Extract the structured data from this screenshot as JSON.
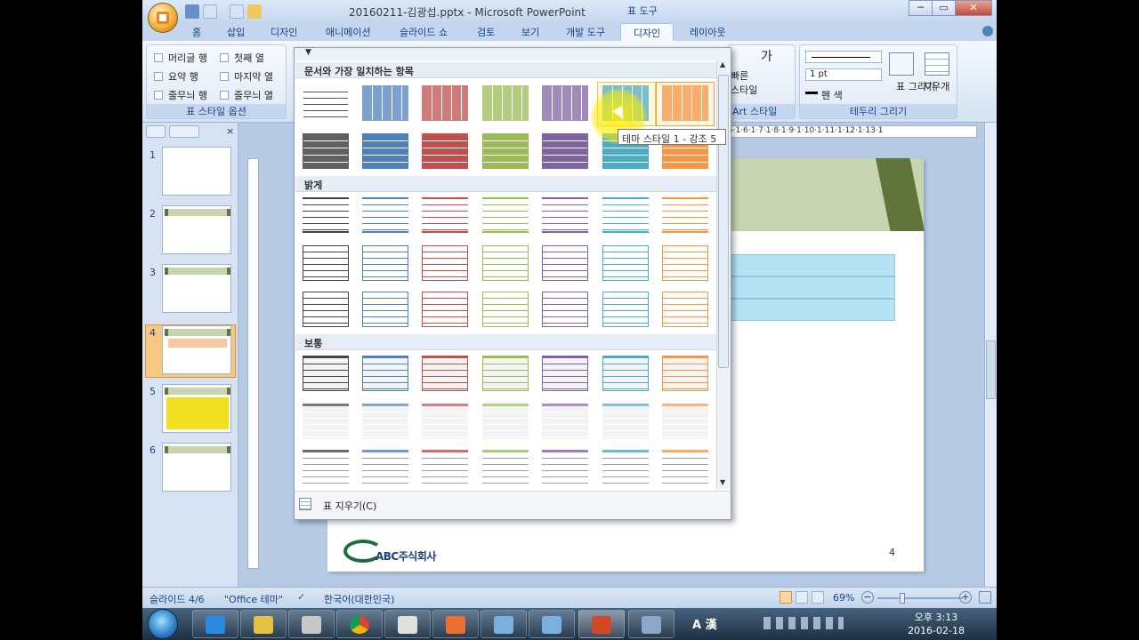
{
  "window": {
    "title": "20160211-김광섭.pptx - Microsoft PowerPoint",
    "context_tab_group": "표 도구",
    "buttons": {
      "minimize": "─",
      "restore": "▭",
      "close": "✕"
    }
  },
  "tabs": [
    "홈",
    "삽입",
    "디자인",
    "애니메이션",
    "슬라이드 쇼",
    "검토",
    "보기",
    "개발 도구",
    "디자인",
    "레이아웃"
  ],
  "active_tab": "디자인",
  "ribbon": {
    "table_style_options": {
      "label": "표 스타일 옵션",
      "options": [
        "머리글 행",
        "첫째 열",
        "요약 행",
        "마지막 열",
        "줄무늬 행",
        "줄무늬 열"
      ]
    },
    "wordart_fragments": [
      "가",
      "빠른",
      "스타일",
      "Art 스타일"
    ],
    "draw_borders": {
      "label": "테두리 그리기",
      "pen_weight": "1 pt",
      "pen_color": "펜 색",
      "draw_table": "표 그리기",
      "eraser": "지우개"
    }
  },
  "gallery": {
    "sections": [
      "문서와 가장 일치하는 항목",
      "밝게",
      "보통"
    ],
    "clear_table": "표 지우기(C)",
    "tooltip": "테마 스타일 1 - 강조 5",
    "accent_colors": [
      "#606060",
      "#4f81bd",
      "#c0504d",
      "#9bbb59",
      "#8064a2",
      "#4bacc6",
      "#f79646"
    ]
  },
  "slide_pane": {
    "slide_numbers": [
      "1",
      "2",
      "3",
      "4",
      "5",
      "6"
    ],
    "selected": "4"
  },
  "ruler": {
    "marks": "·5·1·6·1·7·1·8·1·9·1·10·1·11·1·12·1·13·1"
  },
  "slide": {
    "page_number": "4",
    "logo_text": "ABC주식회사"
  },
  "status": {
    "slide_info": "슬라이드 4/6",
    "theme": "\"Office 테마\"",
    "language": "한국어(대한민국)",
    "zoom": "69%"
  },
  "taskbar": {
    "time": "오후 3:13",
    "date": "2016-02-18",
    "ime": "A 漢"
  }
}
